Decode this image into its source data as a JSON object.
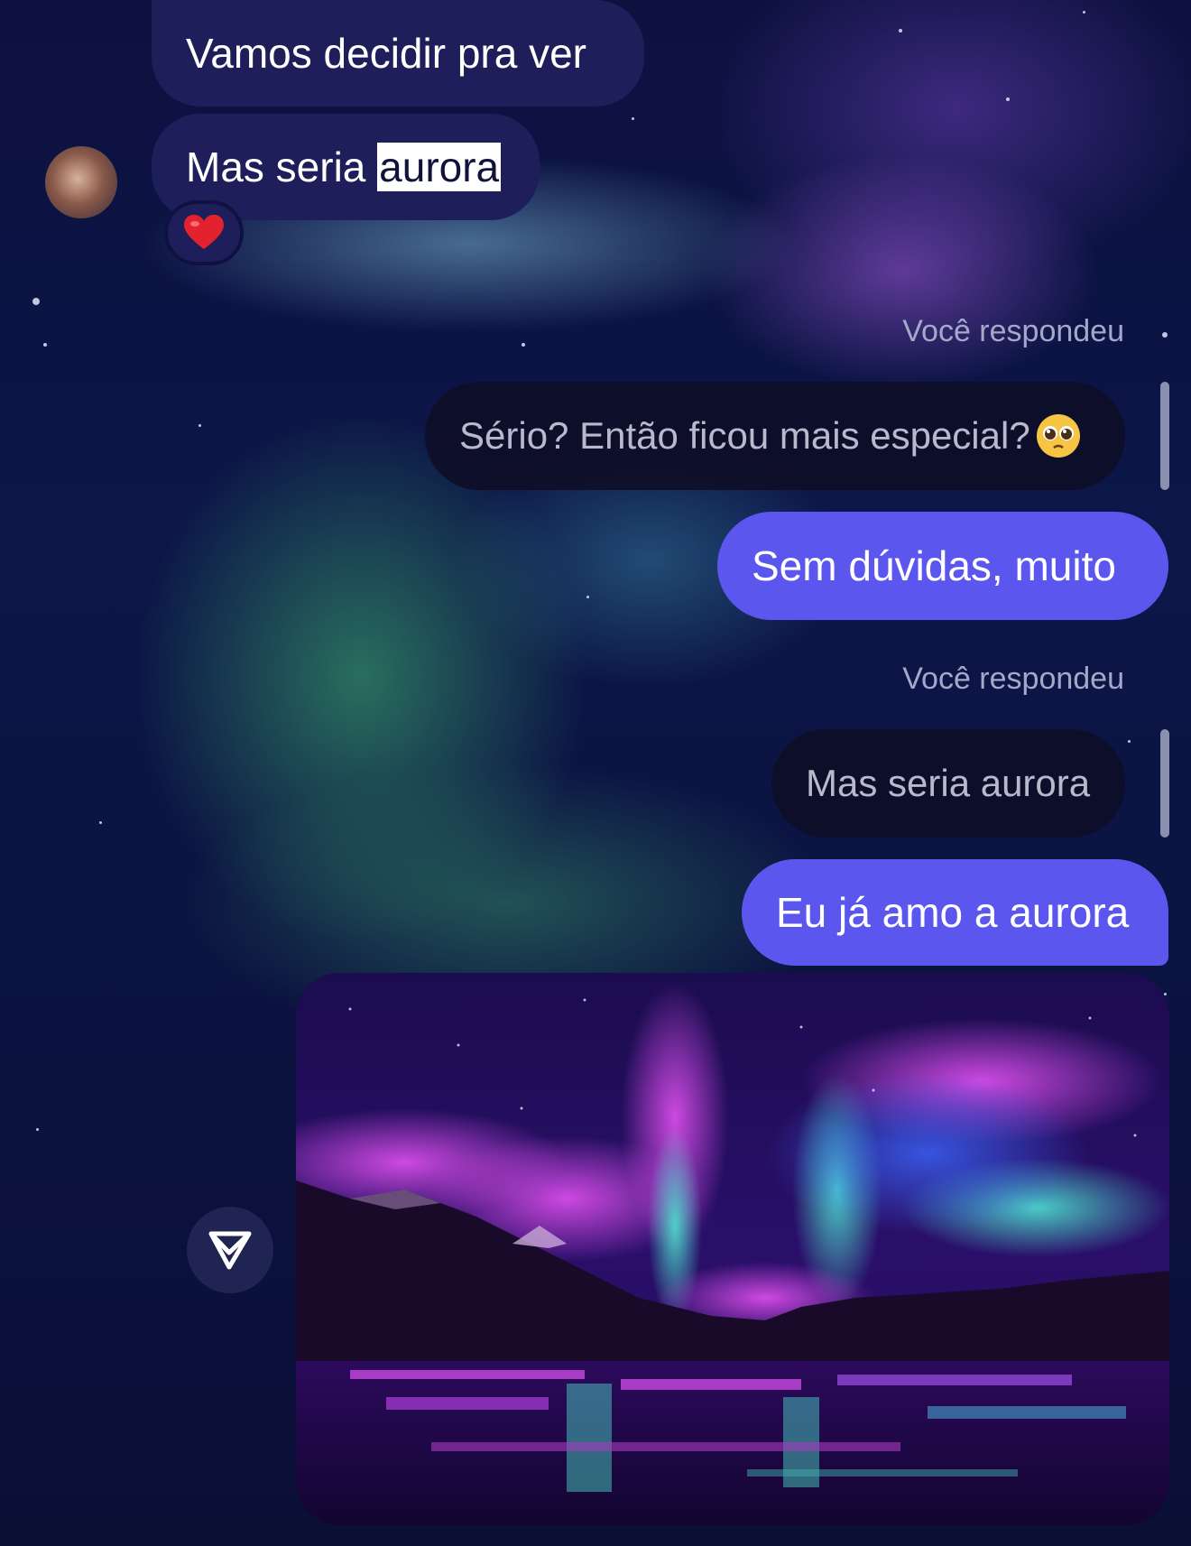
{
  "messages": {
    "incoming_1": "Vamos decidir pra ver",
    "incoming_2_prefix": "Mas seria ",
    "incoming_2_highlight": "aurora",
    "reaction_emoji": "❤️",
    "replied_label_1": "Você respondeu",
    "reply_quote_1": "Sério? Então ficou mais especial?",
    "reply_quote_1_emoji": "🥹",
    "outgoing_1": "Sem dúvidas, muito",
    "replied_label_2": "Você respondeu",
    "reply_quote_2": "Mas seria aurora",
    "outgoing_2": "Eu já amo a aurora"
  },
  "icons": {
    "share": "send-share-icon",
    "heart": "heart-icon"
  },
  "colors": {
    "incoming_bubble": "#1e1e5a",
    "outgoing_bubble": "#5b57ee",
    "reply_bubble": "#0e0e28",
    "reply_label": "#a5a8c8"
  }
}
